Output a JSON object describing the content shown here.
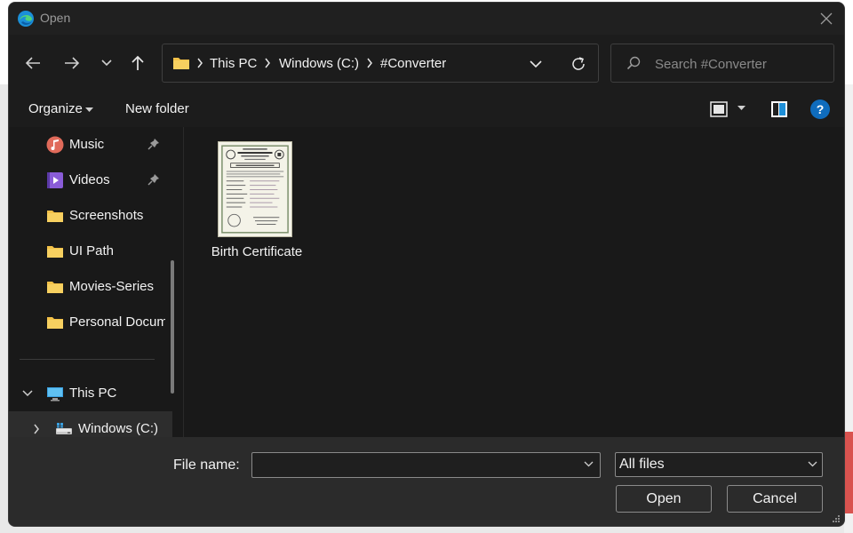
{
  "window": {
    "title": "Open"
  },
  "address": {
    "crumbs": [
      "This PC",
      "Windows (C:)",
      "#Converter"
    ]
  },
  "search": {
    "placeholder": "Search #Converter"
  },
  "commands": {
    "organize": "Organize",
    "new_folder": "New folder",
    "help": "?"
  },
  "sidebar": {
    "items": [
      {
        "label": "Music",
        "icon": "music-icon",
        "pinned": true
      },
      {
        "label": "Videos",
        "icon": "videos-icon",
        "pinned": true
      },
      {
        "label": "Screenshots",
        "icon": "folder-icon"
      },
      {
        "label": "UI Path",
        "icon": "folder-icon"
      },
      {
        "label": "Movies-Series",
        "icon": "folder-icon"
      },
      {
        "label": "Personal Documents",
        "icon": "folder-icon"
      },
      {
        "label": "This PC",
        "icon": "pc-icon",
        "expanded": true
      },
      {
        "label": "Windows (C:)",
        "icon": "drive-icon",
        "expanded": false,
        "selected": true
      }
    ]
  },
  "files": [
    {
      "name": "Birth Certificate",
      "icon": "document-thumbnail"
    }
  ],
  "footer": {
    "file_name_label": "File name:",
    "file_name_value": "",
    "file_type": "All files",
    "open_label": "Open",
    "cancel_label": "Cancel"
  },
  "colors": {
    "dialog_bg": "#202020",
    "pane_bg": "#191919",
    "footer_bg": "#2b2b2b",
    "folder_yellow": "#f3c148",
    "accent_blue": "#0f6cbd"
  }
}
